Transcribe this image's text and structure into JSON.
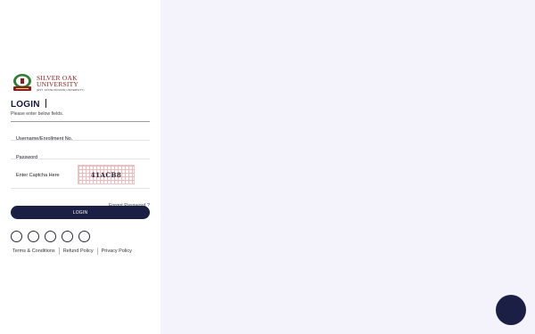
{
  "logo": {
    "name_line1": "SILVER OAK",
    "name_line2": "UNIVERSITY",
    "tagline": "(EST. STATE PRIVATE UNIVERSITY)",
    "emblem": "university-emblem-icon"
  },
  "login": {
    "title": "LOGIN",
    "subtitle": "Please enter below fields."
  },
  "form": {
    "username_placeholder": "Username/Enrollment No.",
    "password_placeholder": "Password",
    "captcha_placeholder": "Enter Captcha Here",
    "captcha_code": "41ACB8",
    "forgot_label": "Forgot Password ?",
    "submit_label": "LOGIN"
  },
  "socials": [
    "facebook-icon",
    "twitter-icon",
    "instagram-icon",
    "linkedin-icon",
    "youtube-icon"
  ],
  "footer": {
    "terms": "Terms & Conditions",
    "refund": "Refund Policy",
    "privacy": "Privacy Policy"
  },
  "colors": {
    "primary": "#1b1f43",
    "right_bg": "#f4f3fc",
    "brand_red": "#8a1c1c"
  },
  "chat": {
    "icon": "chat-icon"
  }
}
